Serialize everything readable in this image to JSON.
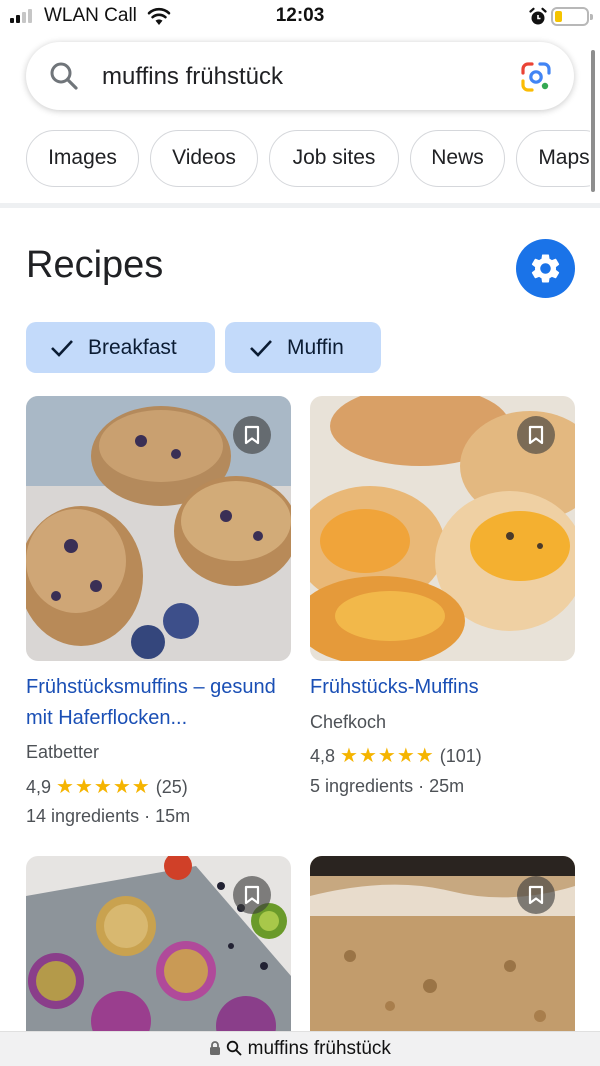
{
  "status_bar": {
    "carrier": "WLAN Call",
    "time": "12:03"
  },
  "search": {
    "query": "muffins frühstück"
  },
  "chips": [
    "Images",
    "Videos",
    "Job sites",
    "News",
    "Maps"
  ],
  "recipes": {
    "heading": "Recipes",
    "filters": [
      "Breakfast",
      "Muffin"
    ],
    "cards": [
      {
        "title": "Frühstücksmuffins – gesund mit Haferflocken...",
        "source": "Eatbetter",
        "rating": "4,9",
        "stars": 5,
        "reviews": "(25)",
        "details": "14 ingredients · 15m"
      },
      {
        "title": "Frühstücks-Muffins",
        "source": "Chefkoch",
        "rating": "4,8",
        "stars": 5,
        "reviews": "(101)",
        "details": "5 ingredients · 25m"
      },
      {
        "title": "",
        "source": "",
        "rating": "",
        "reviews": "",
        "details": ""
      },
      {
        "title": "",
        "source": "",
        "rating": "",
        "reviews": "",
        "details": ""
      }
    ]
  },
  "address_bar": {
    "text": "muffins frühstück"
  },
  "colors": {
    "link": "#1a4fb5",
    "accent": "#1a73e8",
    "filter_bg": "#c3dafa",
    "star": "#f5b400"
  },
  "icons": [
    "signal-icon",
    "wifi-icon",
    "alarm-icon",
    "battery-icon",
    "search-icon",
    "google-lens-icon",
    "settings-gear-icon",
    "checkmark-icon",
    "bookmark-icon",
    "lock-icon"
  ]
}
